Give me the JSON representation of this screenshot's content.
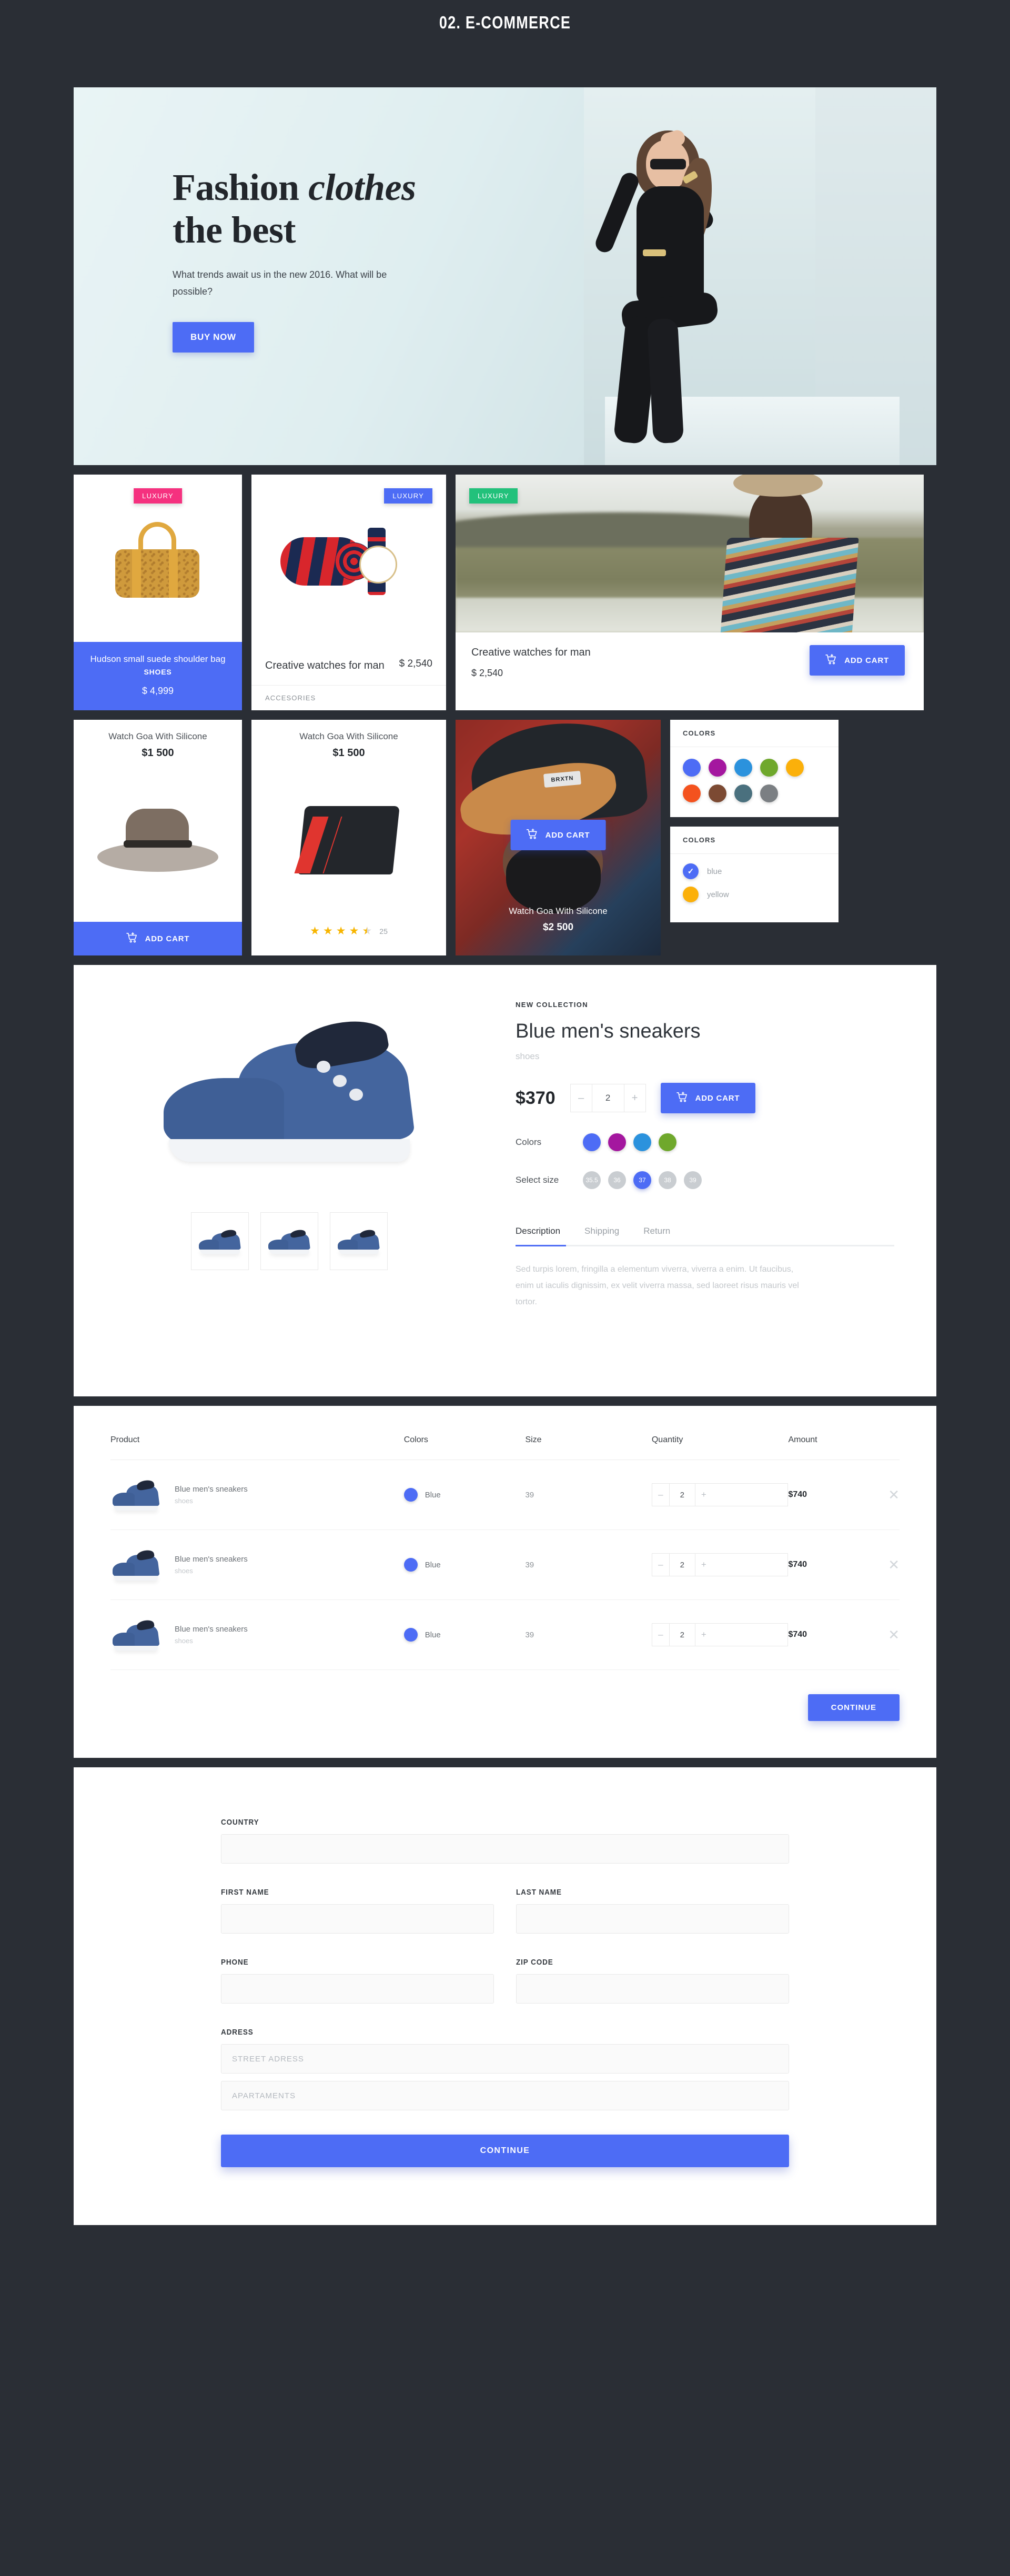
{
  "section": {
    "title": "02. E-COMMERCE"
  },
  "hero": {
    "title_plain": "Fashion ",
    "title_italic": "clothes",
    "title_line2": "the best",
    "subtitle": "What trends await us in the new 2016. What will be possible?",
    "cta": "BUY NOW"
  },
  "colors": {
    "accent_blue": "#4d6cf5",
    "badge_pink": "#f5317f",
    "badge_green": "#22c17b",
    "star_yellow": "#f7b500",
    "page_bg": "#2a2e35"
  },
  "products_row1": [
    {
      "badge": "LUXURY",
      "badge_color": "pink",
      "name": "Hudson small suede shoulder bag",
      "category": "SHOES",
      "price": "$ 4,999"
    },
    {
      "badge": "LUXURY",
      "badge_color": "blue",
      "name": "Creative watches for man",
      "price": "$ 2,540",
      "category": "ACCESORIES"
    },
    {
      "badge": "LUXURY",
      "badge_color": "green",
      "name": "Creative watches for man",
      "price": "$ 2,540",
      "cta": "ADD CART"
    }
  ],
  "products_row2": [
    {
      "name": "Watch Goa With Silicone",
      "price": "$1 500",
      "cta": "ADD CART"
    },
    {
      "name": "Watch Goa With Silicone",
      "price": "$1 500",
      "rating": 4.5,
      "rating_count": "25"
    },
    {
      "name": "Watch Goa With Silicone",
      "price": "$2 500",
      "cta": "ADD CART",
      "cap_label": "BRXTN"
    }
  ],
  "color_panel_1": {
    "title": "COLORS",
    "swatches": [
      "#4d6cf5",
      "#a4179f",
      "#2b92dd",
      "#6fa82c",
      "#fbb00a",
      "#f4521e",
      "#7c4a33",
      "#4a707e",
      "#7b7f83"
    ]
  },
  "color_panel_2": {
    "title": "COLORS",
    "options": [
      {
        "label": "blue",
        "hex": "#4d6cf5",
        "checked": true
      },
      {
        "label": "yellow",
        "hex": "#fbb00a",
        "checked": false
      }
    ]
  },
  "detail": {
    "eyebrow": "NEW COLLECTION",
    "title": "Blue men's sneakers",
    "category": "shoes",
    "price": "$370",
    "quantity": "2",
    "minus": "–",
    "plus": "+",
    "cta": "ADD CART",
    "colors_label": "Colors",
    "color_options": [
      "#4d6cf5",
      "#a4179f",
      "#2b92dd",
      "#6fa82c"
    ],
    "size_label": "Select size",
    "sizes": [
      "35.5",
      "36",
      "37",
      "38",
      "39"
    ],
    "selected_size": "37",
    "tabs": [
      "Description",
      "Shipping",
      "Return"
    ],
    "active_tab": "Description",
    "description": "Sed turpis lorem, fringilla a elementum viverra, viverra a enim. Ut faucibus, enim ut iaculis dignissim, ex velit viverra massa, sed laoreet risus mauris vel tortor."
  },
  "cart": {
    "headers": [
      "Product",
      "Colors",
      "Size",
      "Quantity",
      "Amount"
    ],
    "rows": [
      {
        "name": "Blue men's sneakers",
        "category": "shoes",
        "color_label": "Blue",
        "color_hex": "#4d6cf5",
        "size": "39",
        "qty": "2",
        "amount": "$740"
      },
      {
        "name": "Blue men's sneakers",
        "category": "shoes",
        "color_label": "Blue",
        "color_hex": "#4d6cf5",
        "size": "39",
        "qty": "2",
        "amount": "$740"
      },
      {
        "name": "Blue men's sneakers",
        "category": "shoes",
        "color_label": "Blue",
        "color_hex": "#4d6cf5",
        "size": "39",
        "qty": "2",
        "amount": "$740"
      }
    ],
    "minus": "–",
    "plus": "+",
    "remove_icon": "✕",
    "continue": "CONTINUE"
  },
  "checkout": {
    "country_label": "COUNTRY",
    "country_value": "",
    "first_name_label": "FIRST NAME",
    "first_name_value": "",
    "last_name_label": "LAST NAME",
    "last_name_value": "",
    "phone_label": "PHONE",
    "phone_value": "",
    "zip_label": "ZIP CODE",
    "zip_value": "",
    "address_label": "ADRESS",
    "street_placeholder": "STREET ADRESS",
    "apartments_placeholder": "APARTAMENTS",
    "continue": "CONTINUE"
  }
}
